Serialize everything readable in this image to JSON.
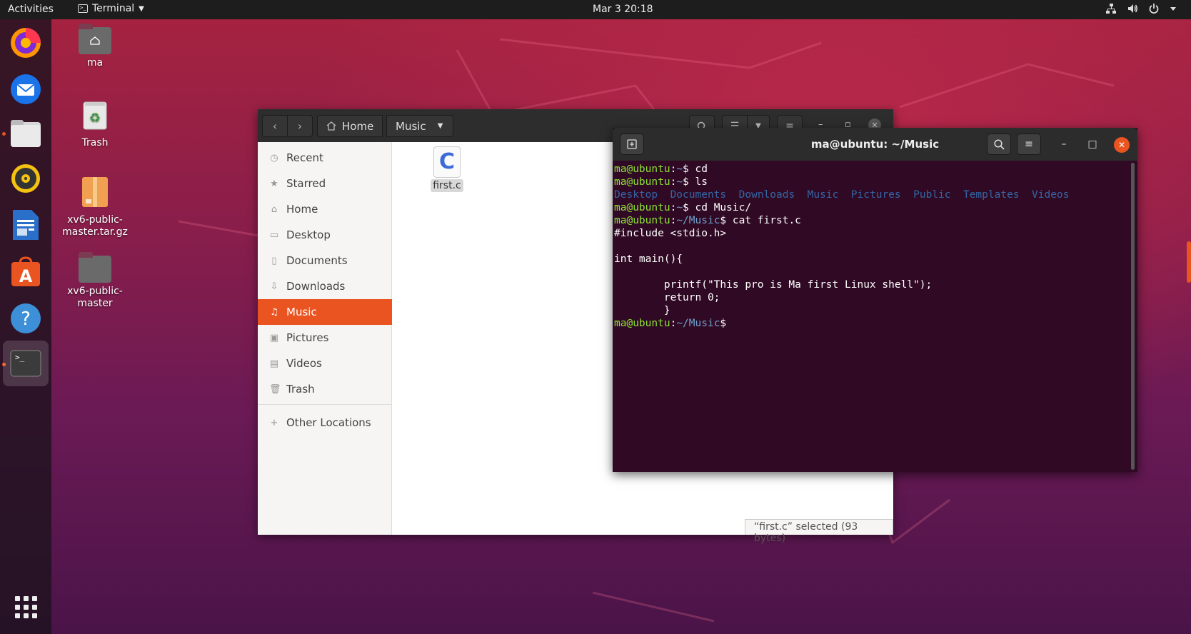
{
  "topbar": {
    "activities": "Activities",
    "app_menu": "Terminal",
    "clock": "Mar 3  20:18",
    "tray_icons": [
      "network-icon",
      "volume-icon",
      "power-icon",
      "caret-down-icon"
    ]
  },
  "dock": {
    "items": [
      "firefox",
      "thunderbird",
      "files",
      "rhythmbox",
      "libreoffice-writer",
      "ubuntu-software",
      "help",
      "terminal"
    ],
    "show_apps_icon": "grid-icon"
  },
  "desktop": {
    "icons": [
      {
        "label": "ma"
      },
      {
        "label": "Trash"
      },
      {
        "label": "xv6-public-master.tar.gz"
      },
      {
        "label": "xv6-public-master"
      }
    ]
  },
  "files": {
    "path": [
      "Home",
      "Music"
    ],
    "sidebar": [
      {
        "label": "Recent",
        "icon": "clock-icon"
      },
      {
        "label": "Starred",
        "icon": "star-icon"
      },
      {
        "label": "Home",
        "icon": "home-icon"
      },
      {
        "label": "Desktop",
        "icon": "folder-icon"
      },
      {
        "label": "Documents",
        "icon": "document-icon"
      },
      {
        "label": "Downloads",
        "icon": "download-icon"
      },
      {
        "label": "Music",
        "icon": "music-icon"
      },
      {
        "label": "Pictures",
        "icon": "picture-icon"
      },
      {
        "label": "Videos",
        "icon": "video-icon"
      },
      {
        "label": "Trash",
        "icon": "trash-icon"
      },
      {
        "label": "Other Locations",
        "icon": "plus-icon"
      }
    ],
    "active_sidebar": "Music",
    "file": {
      "glyph": "C",
      "name": "first.c"
    },
    "status": "“first.c” selected  (93 bytes)"
  },
  "terminal": {
    "title": "ma@ubuntu: ~/Music",
    "lines": [
      [
        {
          "t": "ma@ubuntu",
          "c": "p-user"
        },
        {
          "t": ":"
        },
        {
          "t": "~",
          "c": "p-path"
        },
        {
          "t": "$ cd"
        }
      ],
      [
        {
          "t": "ma@ubuntu",
          "c": "p-user"
        },
        {
          "t": ":"
        },
        {
          "t": "~",
          "c": "p-path"
        },
        {
          "t": "$ ls"
        }
      ],
      [
        {
          "t": "Desktop",
          "c": "dir"
        },
        {
          "t": "  "
        },
        {
          "t": "Documents",
          "c": "dir"
        },
        {
          "t": "  "
        },
        {
          "t": "Downloads",
          "c": "dir"
        },
        {
          "t": "  "
        },
        {
          "t": "Music",
          "c": "dir"
        },
        {
          "t": "  "
        },
        {
          "t": "Pictures",
          "c": "dir"
        },
        {
          "t": "  "
        },
        {
          "t": "Public",
          "c": "dir"
        },
        {
          "t": "  "
        },
        {
          "t": "Templates",
          "c": "dir"
        },
        {
          "t": "  "
        },
        {
          "t": "Videos",
          "c": "dir"
        }
      ],
      [
        {
          "t": "ma@ubuntu",
          "c": "p-user"
        },
        {
          "t": ":"
        },
        {
          "t": "~",
          "c": "p-path"
        },
        {
          "t": "$ cd Music/"
        }
      ],
      [
        {
          "t": "ma@ubuntu",
          "c": "p-user"
        },
        {
          "t": ":"
        },
        {
          "t": "~/Music",
          "c": "p-path"
        },
        {
          "t": "$ cat first.c"
        }
      ],
      [
        {
          "t": "#include <stdio.h>"
        }
      ],
      [
        {
          "t": ""
        }
      ],
      [
        {
          "t": "int main(){"
        }
      ],
      [
        {
          "t": ""
        }
      ],
      [
        {
          "t": "        printf(\"This pro is Ma first Linux shell\");"
        }
      ],
      [
        {
          "t": "        return 0;"
        }
      ],
      [
        {
          "t": "        }"
        }
      ],
      [
        {
          "t": "ma@ubuntu",
          "c": "p-user"
        },
        {
          "t": ":"
        },
        {
          "t": "~/Music",
          "c": "p-path"
        },
        {
          "t": "$"
        }
      ]
    ]
  },
  "colors": {
    "accent": "#e95420",
    "terminal_bg": "#300a24",
    "prompt_user": "#8ae234",
    "prompt_path": "#729fcf",
    "dir_listing": "#3465a4"
  }
}
